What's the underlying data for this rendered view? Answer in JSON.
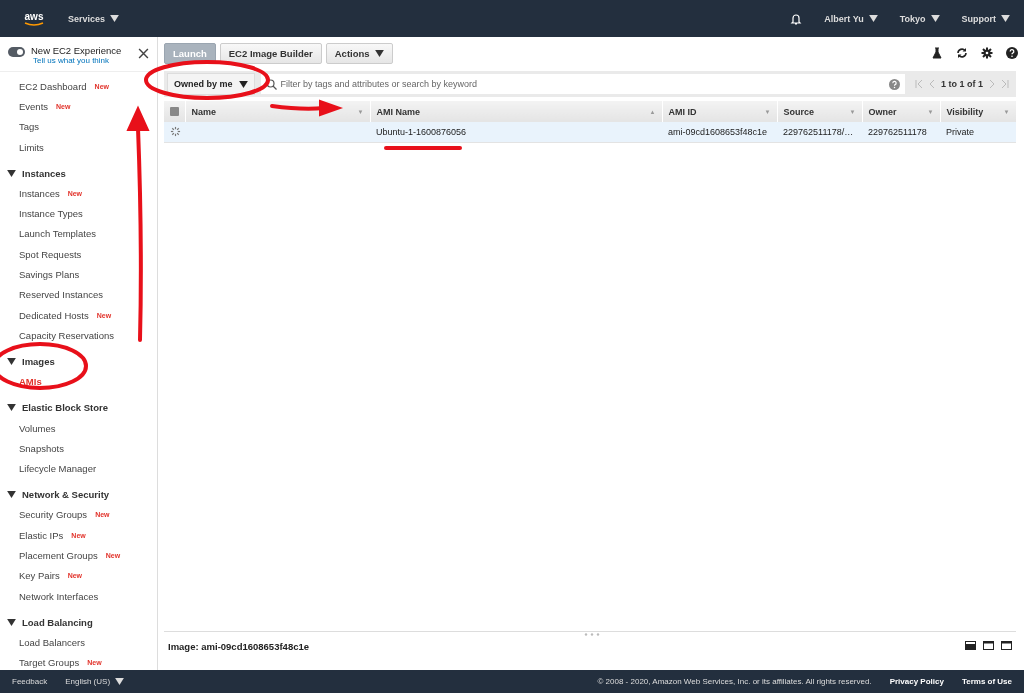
{
  "topbar": {
    "logo": "aws",
    "services": "Services",
    "menus": [
      "Albert Yu",
      "Tokyo",
      "Support"
    ]
  },
  "sidebar": {
    "experience": {
      "title": "New EC2 Experience",
      "subtitle": "Tell us what you think",
      "on": true
    },
    "items": [
      {
        "label": "EC2 Dashboard",
        "new": "New",
        "selected": false
      },
      {
        "label": "Events",
        "new": "New",
        "selected": false
      },
      {
        "label": "Tags",
        "selected": false
      },
      {
        "label": "Limits",
        "selected": false
      }
    ],
    "sections": [
      {
        "title": "Instances",
        "expanded": true,
        "items": [
          {
            "label": "Instances",
            "new": "New",
            "selected": false
          },
          {
            "label": "Instance Types",
            "selected": false
          },
          {
            "label": "Launch Templates",
            "selected": false
          },
          {
            "label": "Spot Requests",
            "selected": false
          },
          {
            "label": "Savings Plans",
            "selected": false
          },
          {
            "label": "Reserved Instances",
            "selected": false
          },
          {
            "label": "Dedicated Hosts",
            "new": "New",
            "selected": false
          },
          {
            "label": "Capacity Reservations",
            "selected": false
          }
        ]
      },
      {
        "title": "Images",
        "expanded": true,
        "items": [
          {
            "label": "AMIs",
            "selected": true
          }
        ]
      },
      {
        "title": "Elastic Block Store",
        "expanded": true,
        "items": [
          {
            "label": "Volumes",
            "selected": false
          },
          {
            "label": "Snapshots",
            "selected": false
          },
          {
            "label": "Lifecycle Manager",
            "selected": false
          }
        ]
      },
      {
        "title": "Network & Security",
        "expanded": true,
        "items": [
          {
            "label": "Security Groups",
            "new": "New",
            "selected": false
          },
          {
            "label": "Elastic IPs",
            "new": "New",
            "selected": false
          },
          {
            "label": "Placement Groups",
            "new": "New",
            "selected": false
          },
          {
            "label": "Key Pairs",
            "new": "New",
            "selected": false
          },
          {
            "label": "Network Interfaces",
            "selected": false
          }
        ]
      },
      {
        "title": "Load Balancing",
        "expanded": true,
        "items": [
          {
            "label": "Load Balancers",
            "selected": false
          },
          {
            "label": "Target Groups",
            "new": "New",
            "selected": false
          }
        ]
      }
    ]
  },
  "toolbar": {
    "buttons": [
      {
        "label": "Launch",
        "disabled": true
      },
      {
        "label": "EC2 Image Builder",
        "disabled": false
      }
    ],
    "actions": "Actions"
  },
  "filter": {
    "scope": "Owned by me",
    "placeholder": "Filter by tags and attributes or search by keyword",
    "pagination": "1 to 1 of 1"
  },
  "table": {
    "select_all_checked": false,
    "columns": [
      {
        "label": "Name",
        "sort_icon": "▼"
      },
      {
        "label": "AMI Name",
        "sort_icon": "▲"
      },
      {
        "label": "AMI ID",
        "sort_icon": "▼"
      },
      {
        "label": "Source",
        "sort_icon": "▼"
      },
      {
        "label": "Owner",
        "sort_icon": "▼"
      },
      {
        "label": "Visibility",
        "sort_icon": "▼"
      }
    ],
    "rows": [
      {
        "selected": true,
        "cells": [
          "",
          "Ubuntu-1-1600876056",
          "ami-09cd1608653f48c1e",
          "229762511178/…",
          "229762511178",
          "Private"
        ]
      }
    ]
  },
  "details": {
    "title": "Image: ami-09cd1608653f48c1e"
  },
  "footer": {
    "feedback": "Feedback",
    "language": "English (US)",
    "copyright": "© 2008 - 2020, Amazon Web Services, Inc. or its affiliates. All rights reserved.",
    "links": [
      "Privacy Policy",
      "Terms of Use"
    ]
  }
}
